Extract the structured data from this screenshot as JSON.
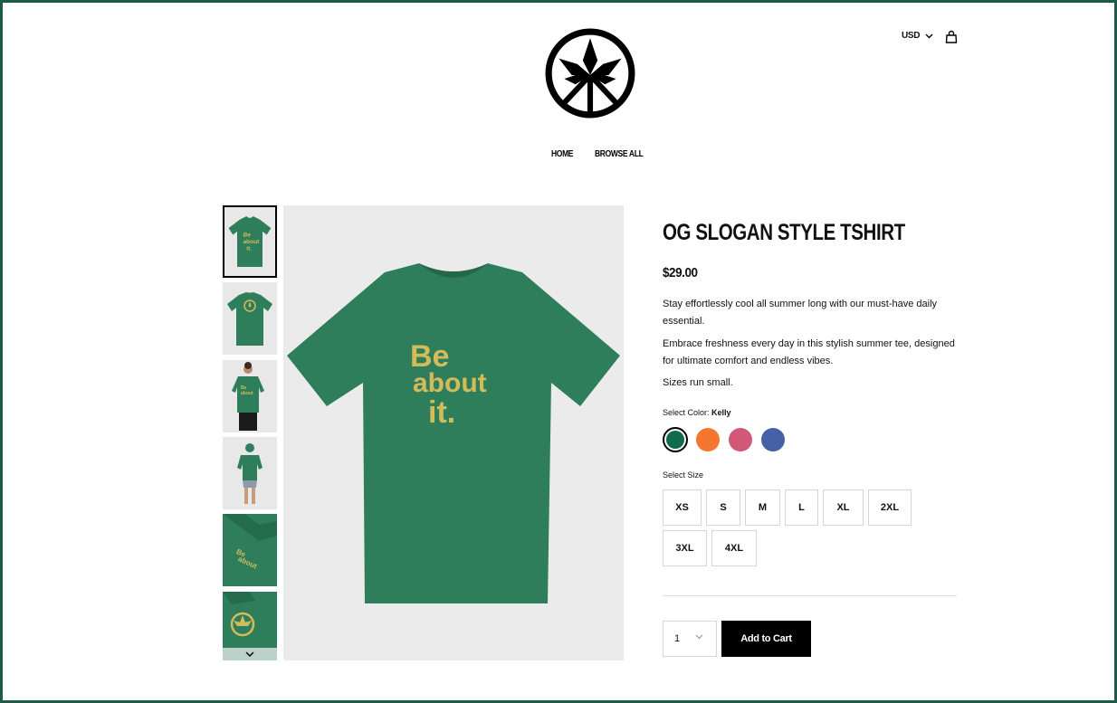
{
  "header": {
    "currency": "USD",
    "nav": [
      "HOME",
      "BROWSE ALL"
    ]
  },
  "icons": {
    "logo": "leaf-circle-logo-icon",
    "currency_chevron": "chevron-down-icon",
    "cart": "shopping-bag-icon",
    "gallery_next": "chevron-down-icon",
    "qty_chevron": "chevron-down-icon"
  },
  "colors": {
    "frame": "#1d5a48",
    "shirt_green": "#2e7e5b",
    "print_gold": "#d3bb5a",
    "button_black": "#000000"
  },
  "product": {
    "title": "OG SLOGAN STYLE TSHIRT",
    "price": "$29.00",
    "description": [
      "Stay effortlessly cool all summer long with our must-have daily essential.",
      "Embrace freshness every day in this stylish summer tee, designed for ultimate comfort and endless vibes.",
      "Sizes run small."
    ],
    "color_label": "Select Color: ",
    "selected_color": "Kelly",
    "colors": [
      {
        "name": "Kelly",
        "hex": "#0f6b4c"
      },
      {
        "name": "Orange",
        "hex": "#f5762f"
      },
      {
        "name": "Pink",
        "hex": "#d25878"
      },
      {
        "name": "Blue",
        "hex": "#4660a8"
      }
    ],
    "size_label": "Select Size",
    "sizes": [
      "XS",
      "S",
      "M",
      "L",
      "XL",
      "2XL",
      "3XL",
      "4XL"
    ],
    "quantity": "1",
    "add_to_cart": "Add to Cart",
    "shirt_print": [
      "Be",
      "about",
      "it."
    ]
  }
}
